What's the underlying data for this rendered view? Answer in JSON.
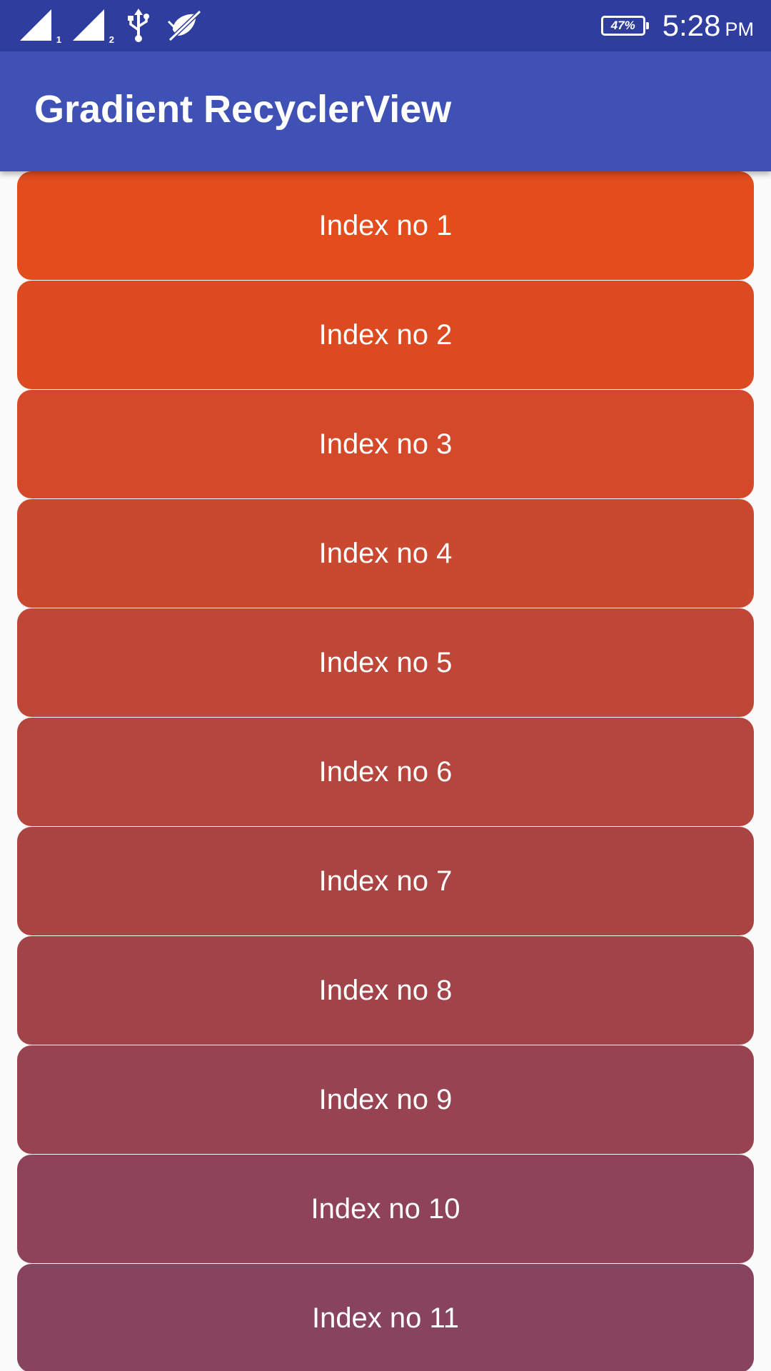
{
  "status_bar": {
    "sim1_label": "1",
    "sim2_label": "2",
    "battery_percent": "47%",
    "time": "5:28",
    "ampm": "PM",
    "icons": [
      "signal-sim1-icon",
      "signal-sim2-icon",
      "usb-icon",
      "muted-notification-icon",
      "battery-icon"
    ]
  },
  "app_bar": {
    "title": "Gradient RecyclerView",
    "color": "#3f51b5"
  },
  "list": {
    "items": [
      {
        "label": "Index no 1",
        "color": "#e34c1c"
      },
      {
        "label": "Index no 2",
        "color": "#db4a21"
      },
      {
        "label": "Index no 3",
        "color": "#d4492a"
      },
      {
        "label": "Index no 4",
        "color": "#c94930"
      },
      {
        "label": "Index no 5",
        "color": "#be4737"
      },
      {
        "label": "Index no 6",
        "color": "#b4463d"
      },
      {
        "label": "Index no 7",
        "color": "#aa4443"
      },
      {
        "label": "Index no 8",
        "color": "#a1444a"
      },
      {
        "label": "Index no 9",
        "color": "#984351"
      },
      {
        "label": "Index no 10",
        "color": "#8f4358"
      },
      {
        "label": "Index no 11",
        "color": "#88445f"
      }
    ]
  }
}
